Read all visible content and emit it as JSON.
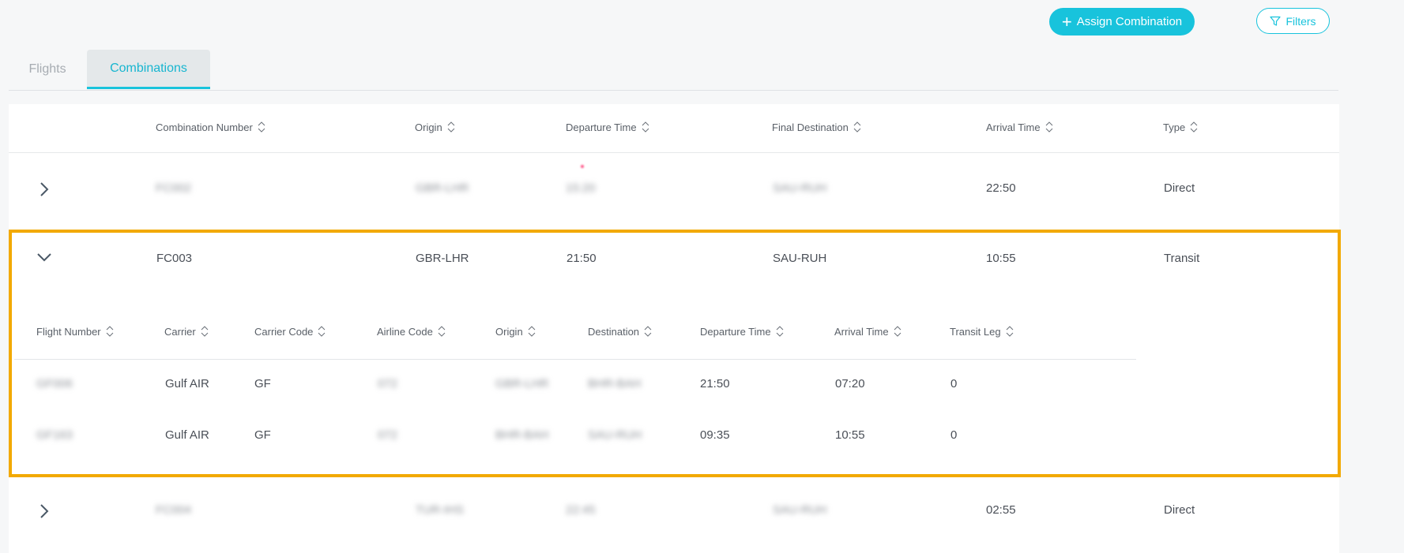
{
  "toolbar": {
    "assign_label": "Assign Combination",
    "filters_label": "Filters"
  },
  "tabs": [
    {
      "label": "Flights",
      "active": false
    },
    {
      "label": "Combinations",
      "active": true
    }
  ],
  "table": {
    "columns": [
      "Combination Number",
      "Origin",
      "Departure Time",
      "Final Destination",
      "Arrival Time",
      "Type"
    ],
    "rows": [
      {
        "combination": "FC002",
        "origin": "GBR-LHR",
        "departure": "15:20",
        "destination": "SAU-RUH",
        "arrival": "22:50",
        "type": "Direct",
        "expanded": false
      },
      {
        "combination": "FC003",
        "origin": "GBR-LHR",
        "departure": "21:50",
        "destination": "SAU-RUH",
        "arrival": "10:55",
        "type": "Transit",
        "expanded": true
      },
      {
        "combination": "FC004",
        "origin": "TUR-IHS",
        "departure": "22:45",
        "destination": "SAU-RUH",
        "arrival": "02:55",
        "type": "Direct",
        "expanded": false
      }
    ]
  },
  "sub_table": {
    "columns": [
      "Flight Number",
      "Carrier",
      "Carrier Code",
      "Airline Code",
      "Origin",
      "Destination",
      "Departure Time",
      "Arrival Time",
      "Transit Leg"
    ],
    "rows": [
      {
        "flight": "GF006",
        "carrier": "Gulf AIR",
        "carrier_code": "GF",
        "airline_code": "072",
        "origin": "GBR-LHR",
        "destination": "BHR-BAH",
        "departure": "21:50",
        "arrival": "07:20",
        "transit_leg": "0"
      },
      {
        "flight": "GF163",
        "carrier": "Gulf AIR",
        "carrier_code": "GF",
        "airline_code": "072",
        "origin": "BHR-BAH",
        "destination": "SAU-RUH",
        "departure": "09:35",
        "arrival": "10:55",
        "transit_leg": "0"
      }
    ]
  },
  "colors": {
    "accent": "#18c3dc",
    "highlight": "#f2a900"
  }
}
